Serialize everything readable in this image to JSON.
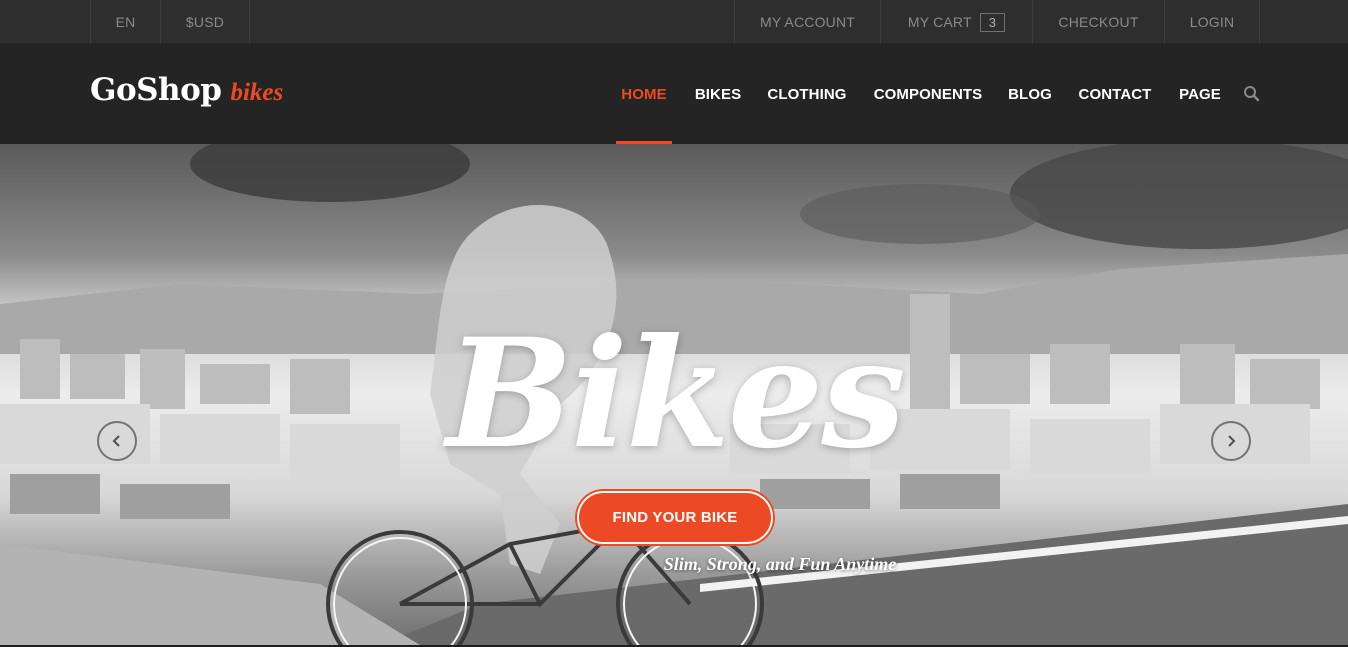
{
  "topbar": {
    "language": "EN",
    "currency": "$USD",
    "my_account": "MY ACCOUNT",
    "my_cart": "MY CART",
    "cart_count": "3",
    "checkout": "CHECKOUT",
    "login": "LOGIN"
  },
  "header": {
    "logo_main": "GoShop",
    "logo_accent": "bikes",
    "nav": [
      {
        "label": "HOME",
        "active": true
      },
      {
        "label": "BIKES"
      },
      {
        "label": "CLOTHING"
      },
      {
        "label": "COMPONENTS"
      },
      {
        "label": "BLOG"
      },
      {
        "label": "CONTACT"
      },
      {
        "label": "PAGE"
      }
    ],
    "search_icon": "search-icon"
  },
  "hero": {
    "title": "Bikes",
    "tagline": "Slim, Strong, and Fun Anytime",
    "cta": "FIND YOUR BIKE",
    "prev_icon": "chevron-left-icon",
    "next_icon": "chevron-right-icon"
  },
  "colors": {
    "accent": "#ec4a24",
    "topbar_bg": "#2e2e2e",
    "header_bg": "#242424"
  }
}
